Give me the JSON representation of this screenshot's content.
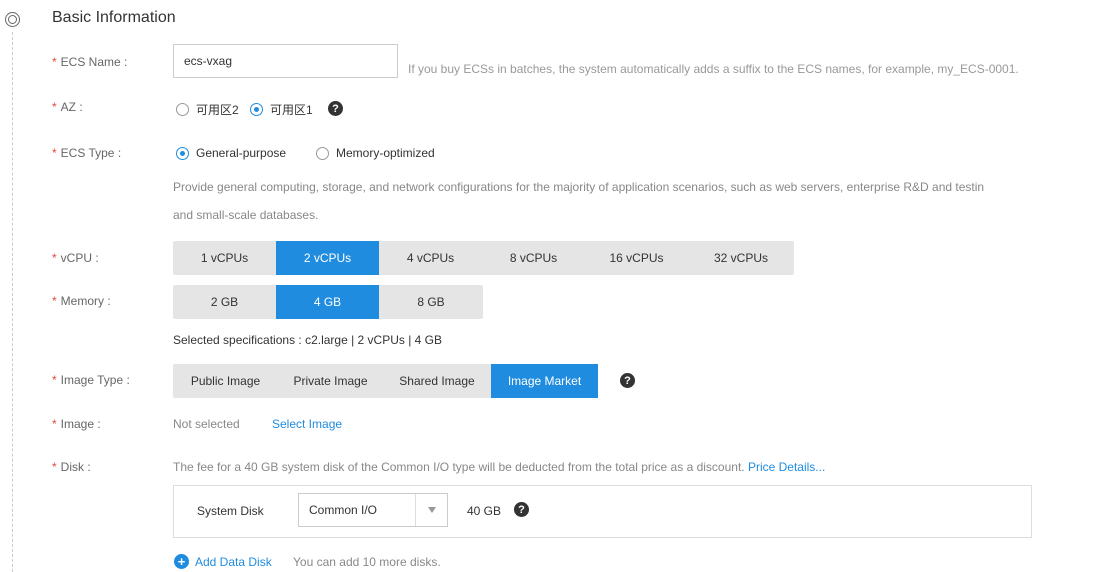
{
  "section": {
    "title": "Basic Information"
  },
  "ecs_name": {
    "label": "ECS Name :",
    "value": "ecs-vxag",
    "hint": "If you buy ECSs in batches, the system automatically adds a suffix to the ECS names, for example, my_ECS-0001."
  },
  "az": {
    "label": "AZ :",
    "options": [
      {
        "label": "可用区2",
        "checked": false
      },
      {
        "label": "可用区1",
        "checked": true
      }
    ]
  },
  "ecs_type": {
    "label": "ECS Type :",
    "options": [
      {
        "label": "General-purpose",
        "checked": true
      },
      {
        "label": "Memory-optimized",
        "checked": false
      }
    ],
    "description_line1": "Provide general computing, storage, and network configurations for the majority of application scenarios, such as web servers, enterprise R&D and testin",
    "description_line2": "and small-scale databases."
  },
  "vcpu": {
    "label": "vCPU :",
    "options": [
      "1 vCPUs",
      "2 vCPUs",
      "4 vCPUs",
      "8 vCPUs",
      "16 vCPUs",
      "32 vCPUs"
    ],
    "selected": "2 vCPUs"
  },
  "memory": {
    "label": "Memory :",
    "options": [
      "2 GB",
      "4 GB",
      "8 GB"
    ],
    "selected": "4 GB",
    "spec_summary": "Selected specifications : c2.large | 2 vCPUs | 4 GB"
  },
  "image_type": {
    "label": "Image Type :",
    "options": [
      "Public Image",
      "Private Image",
      "Shared Image",
      "Image Market"
    ],
    "selected": "Image Market"
  },
  "image": {
    "label": "Image :",
    "status": "Not selected",
    "select_link": "Select Image"
  },
  "disk": {
    "label": "Disk :",
    "notice": "The fee for a 40 GB system disk of the Common I/O type will be deducted from the total price as a discount.",
    "price_link": "Price Details...",
    "system_disk_label": "System Disk",
    "type_value": "Common I/O",
    "size": "40 GB",
    "add_link": "Add Data Disk",
    "add_hint": "You can add 10 more disks."
  },
  "icons": {
    "section": "circle-dot-icon",
    "help": "question-icon",
    "dropdown": "triangle-down-icon",
    "add": "plus-circle-icon"
  },
  "colors": {
    "accent": "#1f8ce0",
    "required": "#e24a3b",
    "segment_bg": "#e5e5e5"
  }
}
